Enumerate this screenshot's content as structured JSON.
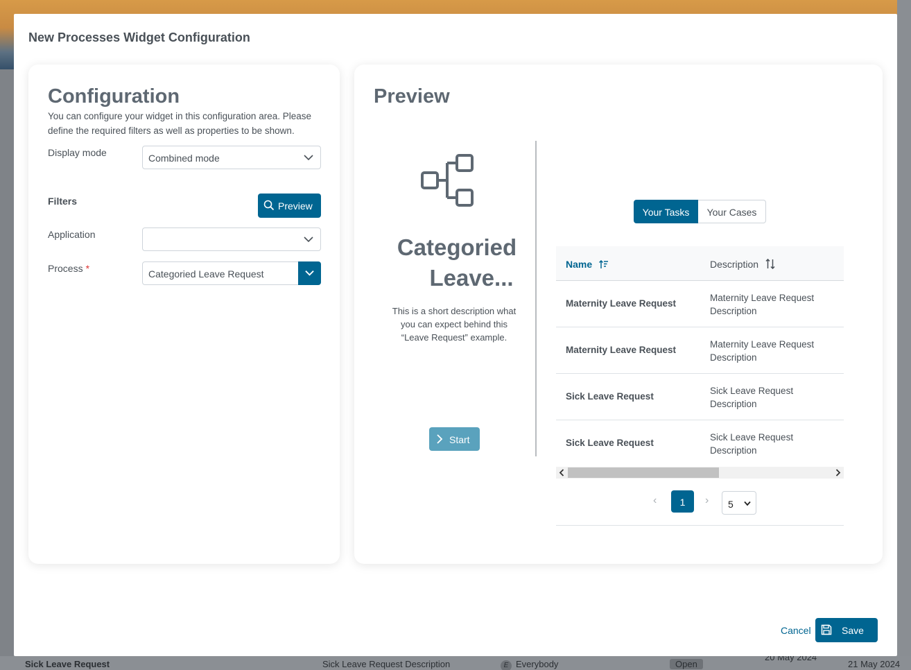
{
  "dialog": {
    "title": "New Processes Widget Configuration",
    "cancel_label": "Cancel",
    "save_label": "Save"
  },
  "config": {
    "heading": "Configuration",
    "description": "You can configure your widget in this configuration area. Please define the required filters as well as properties to be shown.",
    "display_mode_label": "Display mode",
    "display_mode_value": "Combined mode",
    "filters_label": "Filters",
    "preview_button": "Preview",
    "application_label": "Application",
    "application_value": "",
    "process_label": "Process",
    "process_required_mark": "*",
    "process_value": "Categoried Leave Request"
  },
  "preview": {
    "heading": "Preview",
    "process_title_line1": "Categoried",
    "process_title_line2": "Leave...",
    "process_description": "This is a short description what you can expect behind this “Leave Request” example.",
    "start_button": "Start",
    "tabs": [
      {
        "label": "Your Tasks",
        "active": true
      },
      {
        "label": "Your Cases",
        "active": false
      }
    ],
    "table": {
      "columns": [
        "Name",
        "Description"
      ],
      "rows": [
        {
          "name": "Maternity Leave Request",
          "description": "Maternity Leave Request Description"
        },
        {
          "name": "Maternity Leave Request",
          "description": "Maternity Leave Request Description"
        },
        {
          "name": "Sick Leave Request",
          "description": "Sick Leave Request Description"
        },
        {
          "name": "Sick Leave Request",
          "description": "Sick Leave Request Description"
        }
      ]
    },
    "pagination": {
      "prev": "‹",
      "current_page": "1",
      "next": "›",
      "page_size": "5"
    }
  },
  "background": {
    "row_name": "Sick Leave Request",
    "row_description": "Sick Leave Request Description",
    "row_avatar": "E",
    "row_assignee": "Everybody",
    "row_state": "Open",
    "row_date_1": "20 May 2024",
    "row_date_2": "21 May 2024"
  },
  "colors": {
    "primary": "#006591",
    "start_button": "#5aa2bd",
    "heading": "#5e6872"
  }
}
